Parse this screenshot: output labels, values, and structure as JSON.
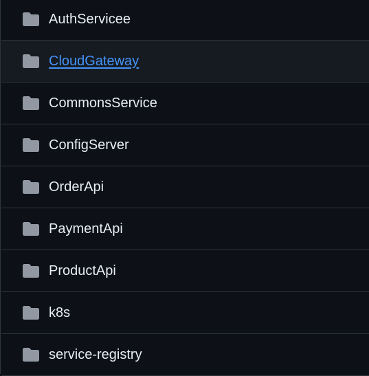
{
  "folders": [
    {
      "name": "AuthServicee",
      "icon": "folder-icon",
      "hovered": false
    },
    {
      "name": "CloudGateway",
      "icon": "folder-icon",
      "hovered": true
    },
    {
      "name": "CommonsService",
      "icon": "folder-icon",
      "hovered": false
    },
    {
      "name": "ConfigServer",
      "icon": "folder-icon",
      "hovered": false
    },
    {
      "name": "OrderApi",
      "icon": "folder-icon",
      "hovered": false
    },
    {
      "name": "PaymentApi",
      "icon": "folder-icon",
      "hovered": false
    },
    {
      "name": "ProductApi",
      "icon": "folder-icon",
      "hovered": false
    },
    {
      "name": "k8s",
      "icon": "folder-icon",
      "hovered": false
    },
    {
      "name": "service-registry",
      "icon": "folder-icon",
      "hovered": false
    }
  ],
  "colors": {
    "background": "#0d1117",
    "hover_background": "#161b22",
    "border": "#30363d",
    "text": "#e6edf3",
    "link": "#4493f8",
    "icon": "#9198a1"
  }
}
